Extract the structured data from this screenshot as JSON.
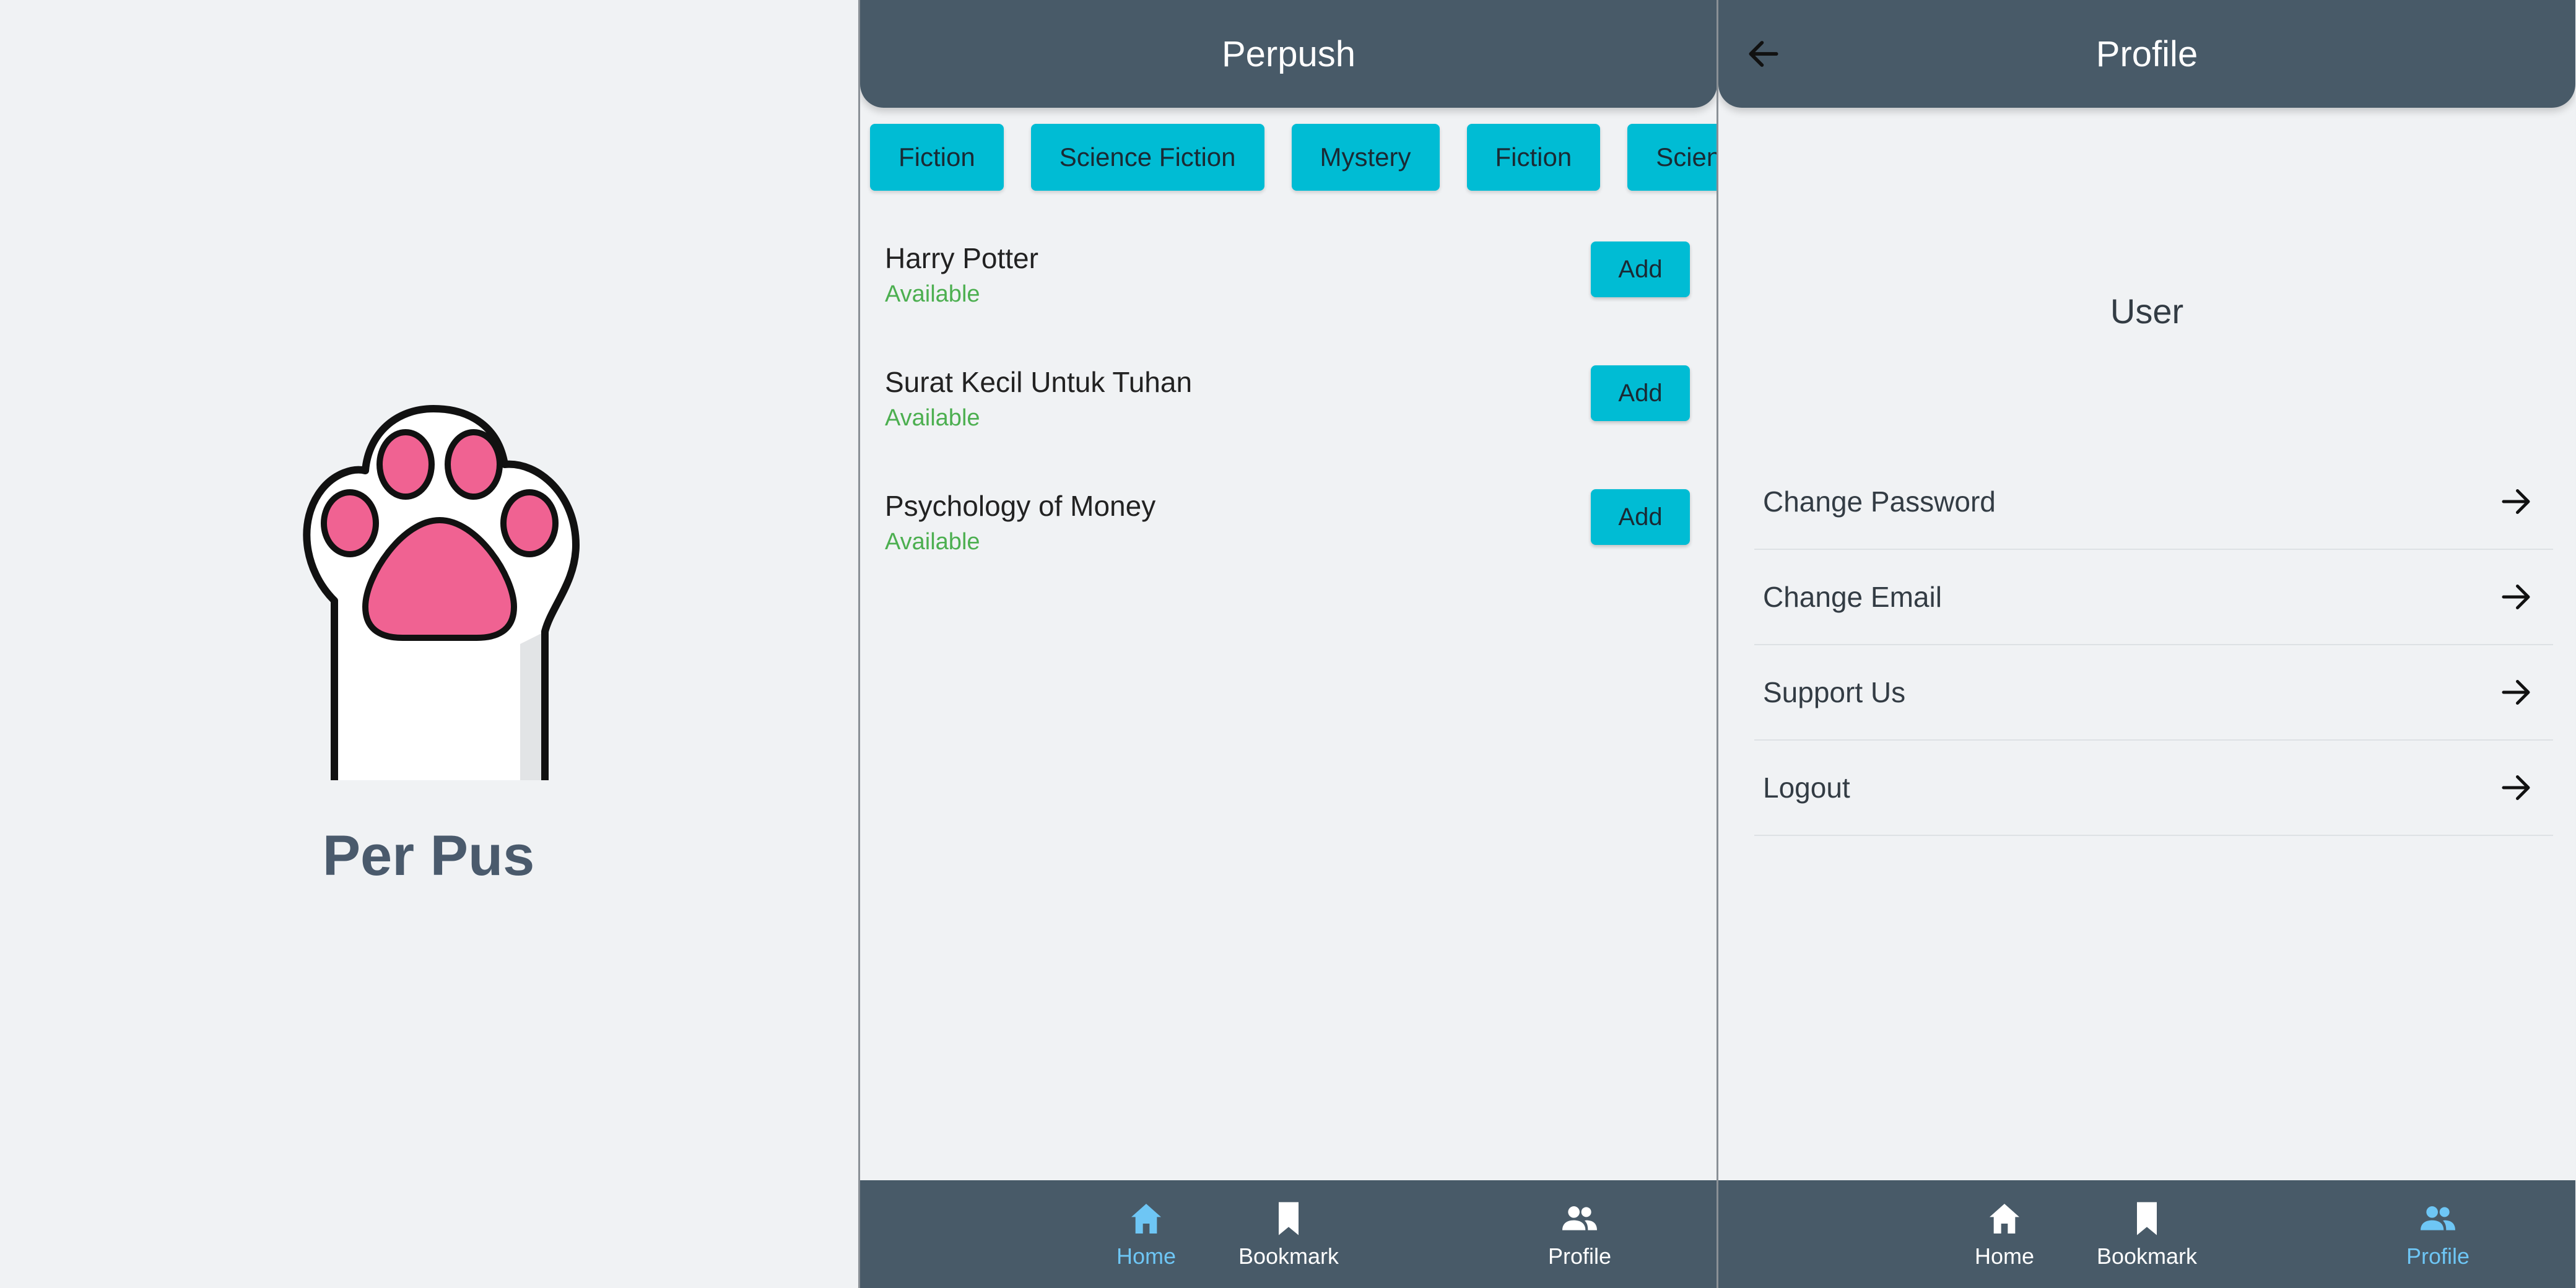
{
  "splash": {
    "app_name": "Per Pus",
    "logo_icon": "paw-icon"
  },
  "home": {
    "title": "Perpush",
    "categories": [
      "Fiction",
      "Science Fiction",
      "Mystery",
      "Fiction",
      "Science"
    ],
    "books": [
      {
        "title": "Harry Potter",
        "status": "Available",
        "action": "Add"
      },
      {
        "title": "Surat Kecil Untuk Tuhan",
        "status": "Available",
        "action": "Add"
      },
      {
        "title": "Psychology of Money",
        "status": "Available",
        "action": "Add"
      }
    ],
    "nav": [
      {
        "label": "Home",
        "icon": "home-icon",
        "active": true
      },
      {
        "label": "Bookmark",
        "icon": "bookmark-icon",
        "active": false
      },
      {
        "label": "Profile",
        "icon": "people-icon",
        "active": false
      }
    ]
  },
  "profile": {
    "title": "Profile",
    "back_icon": "arrow-left-icon",
    "user_name": "User",
    "menu": [
      {
        "label": "Change Password",
        "icon": "arrow-right-icon"
      },
      {
        "label": "Change Email",
        "icon": "arrow-right-icon"
      },
      {
        "label": "Support Us",
        "icon": "arrow-right-icon"
      },
      {
        "label": "Logout",
        "icon": "arrow-right-icon"
      }
    ],
    "nav": [
      {
        "label": "Home",
        "icon": "home-icon",
        "active": false
      },
      {
        "label": "Bookmark",
        "icon": "bookmark-icon",
        "active": false
      },
      {
        "label": "Profile",
        "icon": "people-icon",
        "active": true
      }
    ]
  },
  "colors": {
    "appbar": "#485a68",
    "accent": "#00bcd4",
    "available": "#4caf50",
    "nav_active": "#6ec6f5",
    "paw_pad": "#f06292"
  }
}
